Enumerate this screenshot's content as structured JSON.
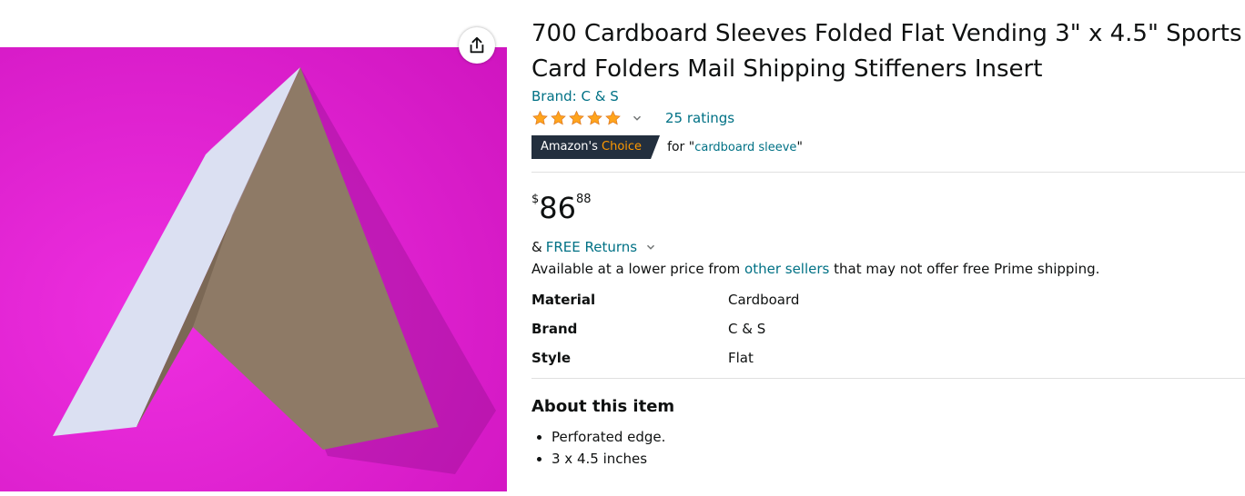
{
  "product": {
    "title": "700 Cardboard Sleeves Folded Flat Vending 3\" x 4.5\" Sports Card Folders Mail Shipping Stiffeners Insert",
    "brand_link": "Brand: C & S",
    "rating_stars": 5,
    "ratings_count_text": "25 ratings",
    "badge": {
      "prefix": "Amazon's",
      "suffix": "Choice",
      "for_prefix": "for \"",
      "for_term": "cardboard sleeve",
      "for_suffix": "\""
    },
    "price": {
      "symbol": "$",
      "whole": "86",
      "fraction": "88"
    },
    "returns": {
      "prefix": "&",
      "link": "FREE Returns"
    },
    "availability": {
      "prefix": "Available at a lower price from ",
      "link": "other sellers",
      "suffix": " that may not offer free Prime shipping."
    },
    "specs": [
      {
        "key": "Material",
        "value": "Cardboard"
      },
      {
        "key": "Brand",
        "value": "C & S"
      },
      {
        "key": "Style",
        "value": "Flat"
      }
    ],
    "about_title": "About this item",
    "bullets": [
      "Perforated edge.",
      "3 x 4.5 inches"
    ]
  },
  "colors": {
    "link": "#007185",
    "star": "#FFA41C",
    "badge_bg": "#232F3E",
    "badge_accent": "#FF9900",
    "image_bg": "#e11fd0"
  },
  "icons": {
    "share": "share-icon",
    "chevron": "chevron-down-icon",
    "star": "star-icon"
  }
}
